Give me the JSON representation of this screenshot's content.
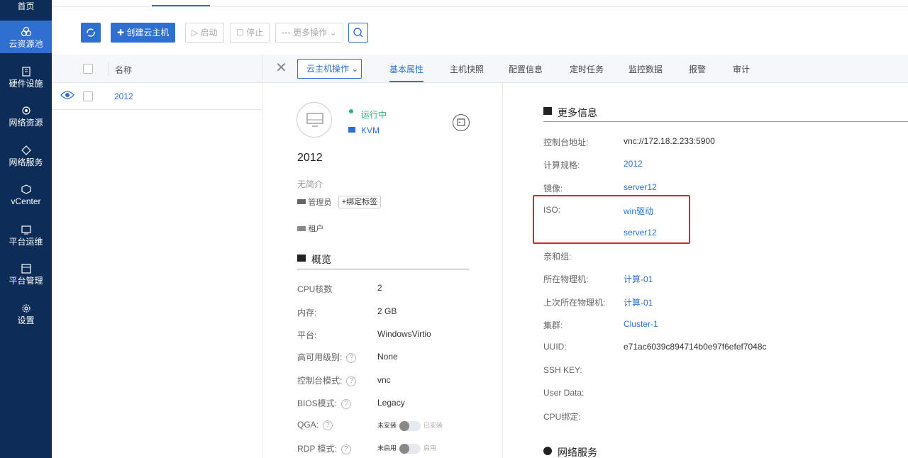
{
  "sidebar": {
    "items": [
      {
        "label": "首页",
        "icon": "home-icon"
      },
      {
        "label": "云资源池",
        "icon": "cloud-pool-icon",
        "active": true
      },
      {
        "label": "硬件设施",
        "icon": "hardware-icon"
      },
      {
        "label": "网络资源",
        "icon": "network-resource-icon"
      },
      {
        "label": "网络服务",
        "icon": "network-service-icon"
      },
      {
        "label": "vCenter",
        "icon": "vcenter-icon"
      },
      {
        "label": "平台运维",
        "icon": "ops-icon"
      },
      {
        "label": "平台管理",
        "icon": "admin-icon"
      },
      {
        "label": "设置",
        "icon": "gear-icon"
      }
    ]
  },
  "toolbar": {
    "create_label": "创建云主机",
    "start_label": "启动",
    "stop_label": "停止",
    "more_label": "更多操作"
  },
  "list": {
    "header_name": "名称",
    "rows": [
      {
        "name": "2012"
      }
    ]
  },
  "detail": {
    "ops_label": "云主机操作",
    "tabs": [
      "基本属性",
      "主机快照",
      "配置信息",
      "定时任务",
      "监控数据",
      "报警",
      "审计"
    ],
    "active_tab": "基本属性",
    "status": "运行中",
    "hypervisor": "KVM",
    "vm_name": "2012",
    "description": "无简介",
    "owner_label": "管理员",
    "bind_tag_label": "+绑定标签",
    "tenant_label": "租户",
    "overview_title": "概览",
    "overview": {
      "cpu": {
        "label": "CPU核数",
        "value": "2"
      },
      "memory": {
        "label": "内存:",
        "value": "2 GB"
      },
      "platform": {
        "label": "平台:",
        "value": "WindowsVirtio"
      },
      "ha": {
        "label": "高可用级别:",
        "value": "None"
      },
      "console_mode": {
        "label": "控制台模式:",
        "value": "vnc"
      },
      "bios": {
        "label": "BIOS模式:",
        "value": "Legacy"
      },
      "qga": {
        "label": "QGA:",
        "off_text": "未安装",
        "on_text": "已安装"
      },
      "rdp": {
        "label": "RDP 模式:",
        "off_text": "未启用",
        "on_text": "启用"
      }
    },
    "more_info_title": "更多信息",
    "more_info": {
      "console_addr": {
        "label": "控制台地址:",
        "value": "vnc://172.18.2.233:5900"
      },
      "spec": {
        "label": "计算规格:",
        "value": "2012"
      },
      "image": {
        "label": "镜像:",
        "value": "server12"
      },
      "iso": {
        "label": "ISO:",
        "value1": "win驱动",
        "value2": "server12"
      },
      "affinity": {
        "label": "亲和组:"
      },
      "host": {
        "label": "所在物理机:",
        "value": "计算-01"
      },
      "last_host": {
        "label": "上次所在物理机:",
        "value": "计算-01"
      },
      "cluster": {
        "label": "集群:",
        "value": "Cluster-1"
      },
      "uuid": {
        "label": "UUID:",
        "value": "e71ac6039c894714b0e97f6efef7048c"
      },
      "ssh_key": {
        "label": "SSH KEY:"
      },
      "user_data": {
        "label": "User Data:"
      },
      "cpu_pin": {
        "label": "CPU绑定:"
      }
    },
    "network_title": "网络服务"
  },
  "colors": {
    "sidebar_bg": "#0d2c57",
    "accent": "#2f6fd0",
    "running": "#2bb673",
    "highlight_box": "#e02424"
  }
}
